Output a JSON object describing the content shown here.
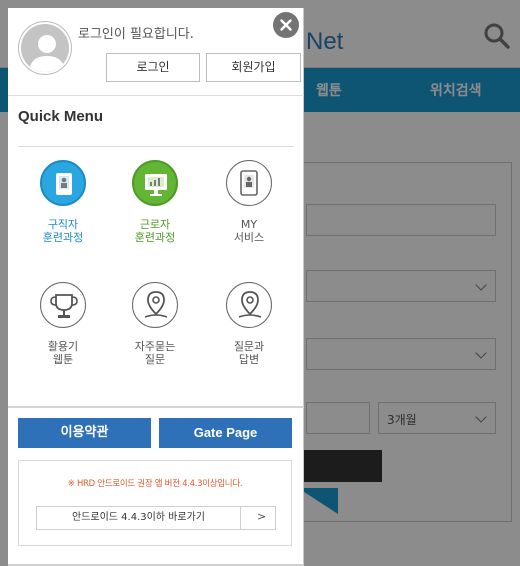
{
  "background": {
    "logo_text": "Net",
    "nav_items": [
      "웹툰",
      "위치검색"
    ],
    "select_value": "3개월",
    "colors": {
      "nav": "#1a9bd4",
      "logo": "#2f79b6"
    }
  },
  "drawer": {
    "login_message": "로그인이 필요합니다.",
    "login_label": "로그인",
    "join_label": "회원가입",
    "quick_menu_title": "Quick Menu",
    "items": [
      {
        "icon": "jobseeker-icon",
        "line1": "구직자",
        "line2": "훈련과정",
        "color": "#1a9bd4"
      },
      {
        "icon": "worker-icon",
        "line1": "근로자",
        "line2": "훈련과정",
        "color": "#5aaa2f"
      },
      {
        "icon": "my-service-icon",
        "line1": "MY",
        "line2": "서비스",
        "color": "#555555"
      },
      {
        "icon": "trophy-icon",
        "line1": "활용기",
        "line2": "웹툰",
        "color": "#555555"
      },
      {
        "icon": "location-pin-icon",
        "line1": "자주묻는",
        "line2": "질문",
        "color": "#555555"
      },
      {
        "icon": "location-pin-icon",
        "line1": "질문과",
        "line2": "답변",
        "color": "#555555"
      }
    ],
    "terms_label": "이용약관",
    "gate_label": "Gate Page",
    "notice_text": "※ HRD 안드로이드 권장 앱 버전 4.4.3이상입니다.",
    "shortcut_label": "안드로이드 4.4.3이하 바로가기",
    "shortcut_arrow": ">",
    "colors": {
      "button": "#2f71b8",
      "notice": "#e05a2a"
    }
  }
}
